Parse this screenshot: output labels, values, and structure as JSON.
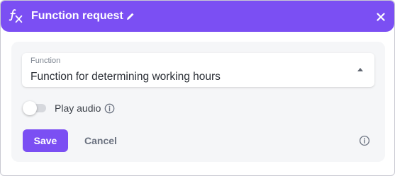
{
  "header": {
    "title": "Function request",
    "icon": "function-fx-icon",
    "edit_icon": "pencil-icon",
    "close_icon": "close-icon",
    "accent_color": "#7b4ff3"
  },
  "form": {
    "function_field": {
      "label": "Function",
      "value": "Function for determining working hours",
      "dropdown_icon": "caret-up-icon"
    },
    "play_audio": {
      "label": "Play audio",
      "enabled": false,
      "info_icon": "info-icon"
    }
  },
  "actions": {
    "save_label": "Save",
    "cancel_label": "Cancel",
    "info_icon": "info-icon"
  }
}
